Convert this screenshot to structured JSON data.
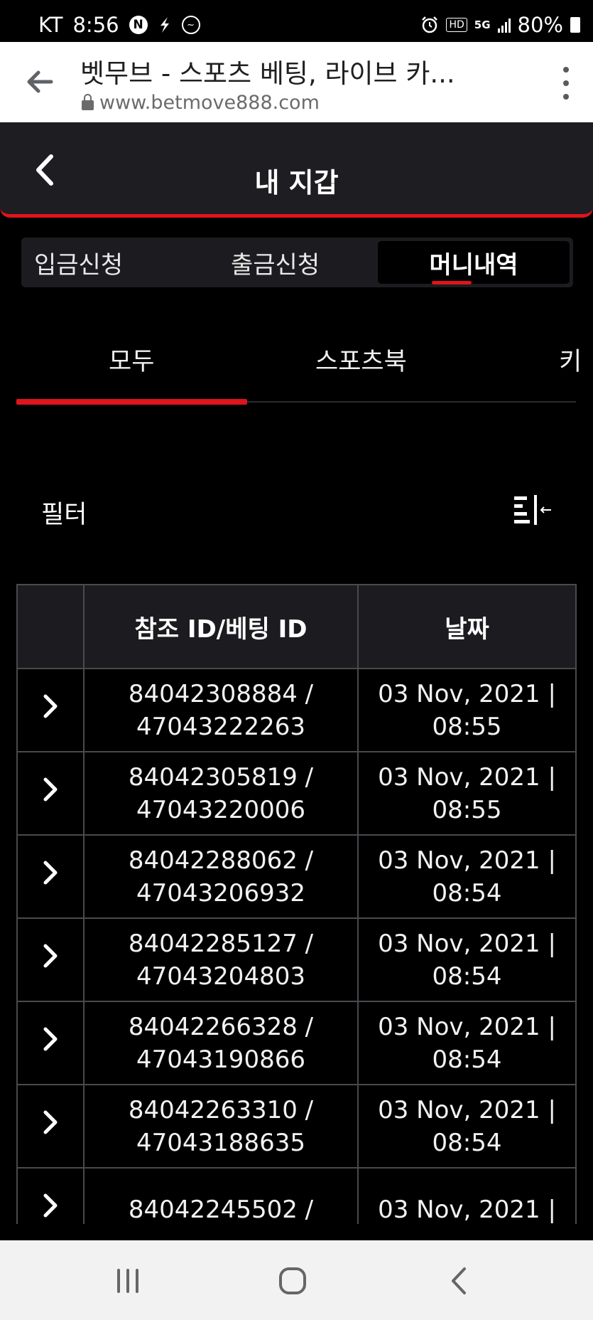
{
  "status": {
    "carrier": "KT",
    "time": "8:56",
    "network": "5G",
    "battery": "80%",
    "left_icons": [
      "naver-icon",
      "app-notification-icon",
      "messenger-icon"
    ],
    "right_icons": [
      "alarm-icon",
      "hd-voice-icon",
      "5g-icon",
      "signal-icon",
      "battery-icon"
    ]
  },
  "browser": {
    "title": "벳무브 - 스포츠 베팅, 라이브 카...",
    "url": "www.betmove888.com"
  },
  "header": {
    "title": "내 지갑",
    "accent": "#e0141b"
  },
  "wallet_tabs": [
    {
      "label": "입금신청",
      "active": false
    },
    {
      "label": "출금신청",
      "active": false
    },
    {
      "label": "머니내역",
      "active": true
    }
  ],
  "category_tabs": [
    {
      "label": "모두",
      "active": true
    },
    {
      "label": "스포츠북",
      "active": false
    },
    {
      "label": "키",
      "active": false
    }
  ],
  "filter": {
    "label": "필터",
    "icon": "filter-toggle-icon"
  },
  "table": {
    "columns": [
      "",
      "참조 ID/베팅 ID",
      "날짜"
    ],
    "rows": [
      {
        "ref": "84042308884 /",
        "bet": "47043222263",
        "date": "03 Nov, 2021 |",
        "time": "08:55"
      },
      {
        "ref": "84042305819 /",
        "bet": "47043220006",
        "date": "03 Nov, 2021 |",
        "time": "08:55"
      },
      {
        "ref": "84042288062 /",
        "bet": "47043206932",
        "date": "03 Nov, 2021 |",
        "time": "08:54"
      },
      {
        "ref": "84042285127 /",
        "bet": "47043204803",
        "date": "03 Nov, 2021 |",
        "time": "08:54"
      },
      {
        "ref": "84042266328 /",
        "bet": "47043190866",
        "date": "03 Nov, 2021 |",
        "time": "08:54"
      },
      {
        "ref": "84042263310 /",
        "bet": "47043188635",
        "date": "03 Nov, 2021 |",
        "time": "08:54"
      },
      {
        "ref": "84042245502 /",
        "bet": "",
        "date": "03 Nov, 2021 |",
        "time": ""
      }
    ]
  },
  "navbar": {
    "items": [
      "recent-apps-icon",
      "home-icon",
      "back-icon"
    ]
  }
}
